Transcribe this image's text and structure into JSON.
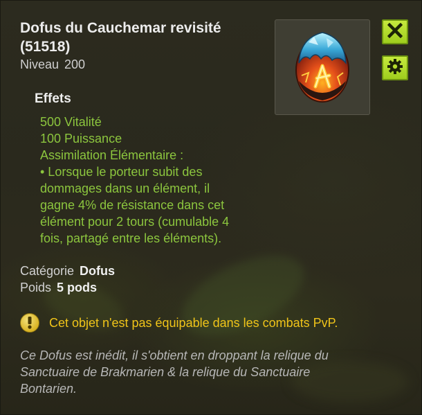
{
  "item": {
    "name": "Dofus du Cauchemar revisité",
    "id_line": "(51518)",
    "level_label": "Niveau",
    "level_value": "200",
    "image_icon": "dofus-nightmare-egg-icon"
  },
  "buttons": {
    "close_icon": "close-x-icon",
    "settings_icon": "gear-icon"
  },
  "effects": {
    "heading": "Effets",
    "lines": [
      "500 Vitalité",
      "100 Puissance",
      "Assimilation Élémentaire :",
      "• Lorsque le porteur subit des",
      "dommages dans un élément, il",
      "gagne 4% de résistance dans cet",
      "élément pour 2 tours (cumulable 4",
      "fois, partagé entre les éléments)."
    ]
  },
  "meta": {
    "category_label": "Catégorie",
    "category_value": "Dofus",
    "weight_label": "Poids",
    "weight_value": "5 pods"
  },
  "warning": {
    "icon": "exclamation-icon",
    "text": "Cet objet n'est pas équipable dans les combats PvP."
  },
  "lore": {
    "lines": [
      "Ce Dofus est inédit, il s'obtient en droppant la relique du",
      "Sanctuaire de Brakmarien & la relique du Sanctuaire",
      "Bontarien."
    ]
  },
  "colors": {
    "effect_text": "#8cc63e",
    "warning_text": "#f0c419",
    "button_green": "#b4dd2e",
    "background": "#2c2b1f"
  }
}
